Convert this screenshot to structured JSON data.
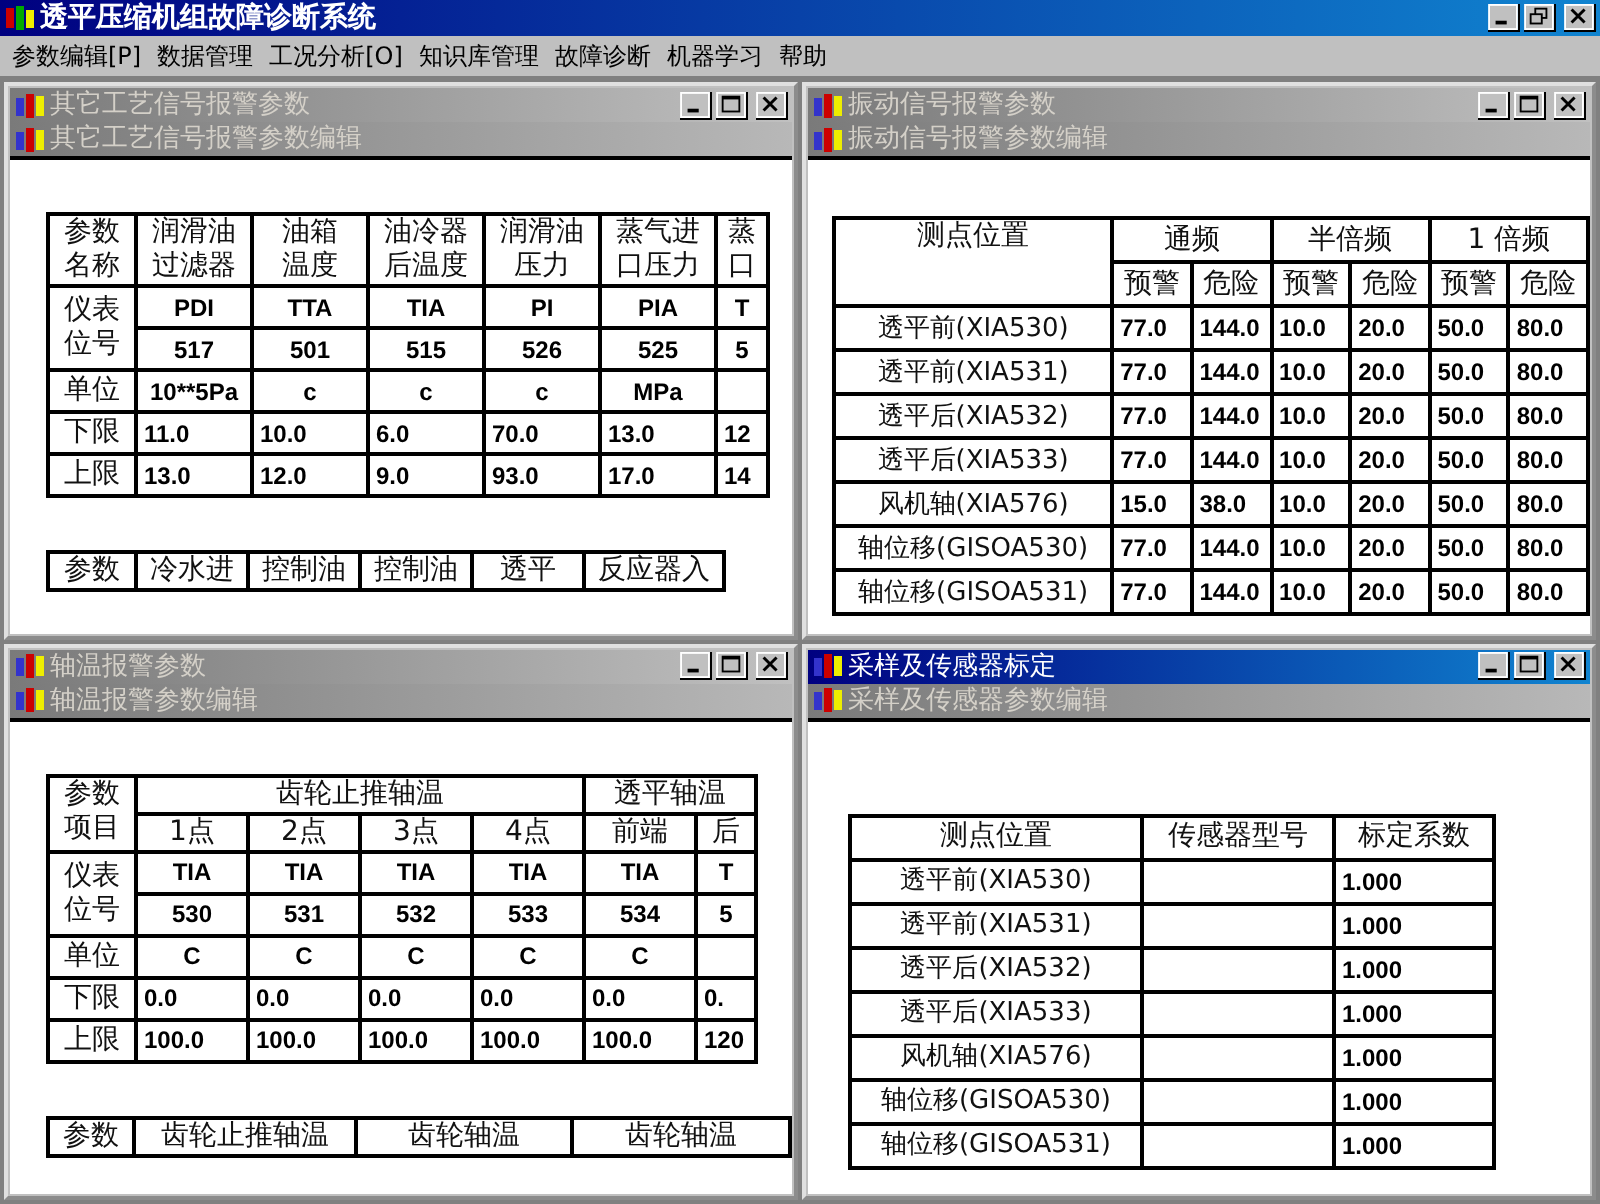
{
  "app": {
    "title": "透平压缩机组故障诊断系统"
  },
  "menu": [
    "参数编辑[P]",
    "数据管理",
    "工况分析[O]",
    "知识库管理",
    "故障诊断",
    "机器学习",
    "帮助"
  ],
  "windows": [
    {
      "kind": "process",
      "title": "其它工艺信号报警参数",
      "subtitle": "其它工艺信号报警参数编辑",
      "active": false,
      "row_labels": {
        "name": [
          "参数",
          "名称"
        ],
        "tag": [
          "仪表",
          "位号"
        ],
        "unit": [
          "单位"
        ],
        "low": [
          "下限"
        ],
        "high": [
          "上限"
        ]
      },
      "columns": [
        {
          "name": [
            "润滑油",
            "过滤器"
          ],
          "tag": "PDI",
          "number": "517",
          "unit": "10**5Pa",
          "low": "11.0",
          "high": "13.0"
        },
        {
          "name": [
            "油箱",
            "温度"
          ],
          "tag": "TTA",
          "number": "501",
          "unit": "c",
          "low": "10.0",
          "high": "12.0"
        },
        {
          "name": [
            "油冷器",
            "后温度"
          ],
          "tag": "TIA",
          "number": "515",
          "unit": "c",
          "low": "6.0",
          "high": "9.0"
        },
        {
          "name": [
            "润滑油",
            "压力"
          ],
          "tag": "PI",
          "number": "526",
          "unit": "c",
          "low": "70.0",
          "high": "93.0"
        },
        {
          "name": [
            "蒸气进",
            "口压力"
          ],
          "tag": "PIA",
          "number": "525",
          "unit": "MPa",
          "low": "13.0",
          "high": "17.0"
        },
        {
          "name": [
            "蒸",
            "口"
          ],
          "tag": "T",
          "number": "5",
          "low": "12",
          "high": "14"
        }
      ],
      "table_2": {
        "label": "参数",
        "columns": [
          "冷水进",
          "控制油",
          "控制油",
          "透平",
          "反应器入"
        ]
      }
    },
    {
      "kind": "vibration",
      "title": "振动信号报警参数",
      "subtitle": "振动信号报警参数编辑",
      "active": false,
      "location_header": "测点位置",
      "groups": [
        {
          "name": "通频",
          "levels": [
            "预警",
            "危险"
          ]
        },
        {
          "name": "半倍频",
          "levels": [
            "预警",
            "危险"
          ]
        },
        {
          "name": "1 倍频",
          "levels": [
            "预警",
            "危险"
          ]
        }
      ],
      "rows": [
        {
          "location": "透平前(XIA530)",
          "values": [
            "77.0",
            "144.0",
            "10.0",
            "20.0",
            "50.0",
            "80.0"
          ]
        },
        {
          "location": "透平前(XIA531)",
          "values": [
            "77.0",
            "144.0",
            "10.0",
            "20.0",
            "50.0",
            "80.0"
          ]
        },
        {
          "location": "透平后(XIA532)",
          "values": [
            "77.0",
            "144.0",
            "10.0",
            "20.0",
            "50.0",
            "80.0"
          ]
        },
        {
          "location": "透平后(XIA533)",
          "values": [
            "77.0",
            "144.0",
            "10.0",
            "20.0",
            "50.0",
            "80.0"
          ]
        },
        {
          "location": "风机轴(XIA576)",
          "values": [
            "15.0",
            "38.0",
            "10.0",
            "20.0",
            "50.0",
            "80.0"
          ]
        },
        {
          "location": "轴位移(GISOA530)",
          "values": [
            "77.0",
            "144.0",
            "10.0",
            "20.0",
            "50.0",
            "80.0"
          ]
        },
        {
          "location": "轴位移(GISOA531)",
          "values": [
            "77.0",
            "144.0",
            "10.0",
            "20.0",
            "50.0",
            "80.0"
          ]
        }
      ]
    },
    {
      "kind": "bearing",
      "title": "轴温报警参数",
      "subtitle": "轴温报警参数编辑",
      "active": false,
      "row_labels": {
        "name": [
          "参数",
          "项目"
        ],
        "tag": [
          "仪表",
          "位号"
        ],
        "unit": [
          "单位"
        ],
        "low": [
          "下限"
        ],
        "high": [
          "上限"
        ]
      },
      "groups": [
        {
          "name": "齿轮止推轴温",
          "points": [
            {
              "name": "1点",
              "tag": "TIA",
              "number": "530",
              "unit": "C",
              "low": "0.0",
              "high": "100.0"
            },
            {
              "name": "2点",
              "tag": "TIA",
              "number": "531",
              "unit": "C",
              "low": "0.0",
              "high": "100.0"
            },
            {
              "name": "3点",
              "tag": "TIA",
              "number": "532",
              "unit": "C",
              "low": "0.0",
              "high": "100.0"
            },
            {
              "name": "4点",
              "tag": "TIA",
              "number": "533",
              "unit": "C",
              "low": "0.0",
              "high": "100.0"
            }
          ]
        },
        {
          "name": "透平轴温",
          "points": [
            {
              "name": "前端",
              "tag": "TIA",
              "number": "534",
              "unit": "C",
              "low": "0.0",
              "high": "100.0"
            },
            {
              "name": "后",
              "tag": "T",
              "number": "5",
              "low": "0.",
              "high": "120"
            }
          ]
        }
      ],
      "table_2": {
        "label": "参数",
        "columns": [
          "齿轮止推轴温",
          "齿轮轴温",
          "齿轮轴温"
        ]
      }
    },
    {
      "kind": "sensor",
      "title": "采样及传感器标定",
      "subtitle": "采样及传感器参数编辑",
      "active": true,
      "columns": [
        "测点位置",
        "传感器型号",
        "标定系数"
      ],
      "rows": [
        {
          "location": "透平前(XIA530)",
          "coefficient": "1.000"
        },
        {
          "location": "透平前(XIA531)",
          "coefficient": "1.000"
        },
        {
          "location": "透平后(XIA532)",
          "coefficient": "1.000"
        },
        {
          "location": "透平后(XIA533)",
          "coefficient": "1.000"
        },
        {
          "location": "风机轴(XIA576)",
          "coefficient": "1.000"
        },
        {
          "location": "轴位移(GISOA530)",
          "coefficient": "1.000"
        },
        {
          "location": "轴位移(GISOA531)",
          "coefficient": "1.000"
        }
      ]
    }
  ]
}
